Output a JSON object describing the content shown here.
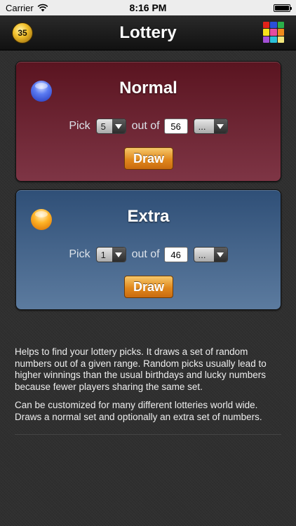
{
  "status_bar": {
    "carrier": "Carrier",
    "time": "8:16 PM"
  },
  "nav": {
    "title": "Lottery",
    "coin_count": "35"
  },
  "grid_colors": [
    "#e2231a",
    "#2b4fd8",
    "#2bb04a",
    "#f7e21b",
    "#e64ba0",
    "#f08a1c",
    "#a44fd6",
    "#2ac0d8",
    "#f2e67c"
  ],
  "normal": {
    "title": "Normal",
    "pick_label": "Pick",
    "pick_value": "5",
    "outof_label": "out of",
    "outof_value": "56",
    "preset_value": "...",
    "draw_label": "Draw"
  },
  "extra": {
    "title": "Extra",
    "pick_label": "Pick",
    "pick_value": "1",
    "outof_label": "out of",
    "outof_value": "46",
    "preset_value": "...",
    "draw_label": "Draw"
  },
  "description": {
    "p1": "Helps to find your lottery picks. It draws a set of random numbers out of a given range. Random picks usually lead to higher winnings than the usual birthdays and lucky numbers because fewer players sharing the same set.",
    "p2": "Can be customized for many different lotteries world wide. Draws a normal set and optionally an extra set of numbers."
  }
}
